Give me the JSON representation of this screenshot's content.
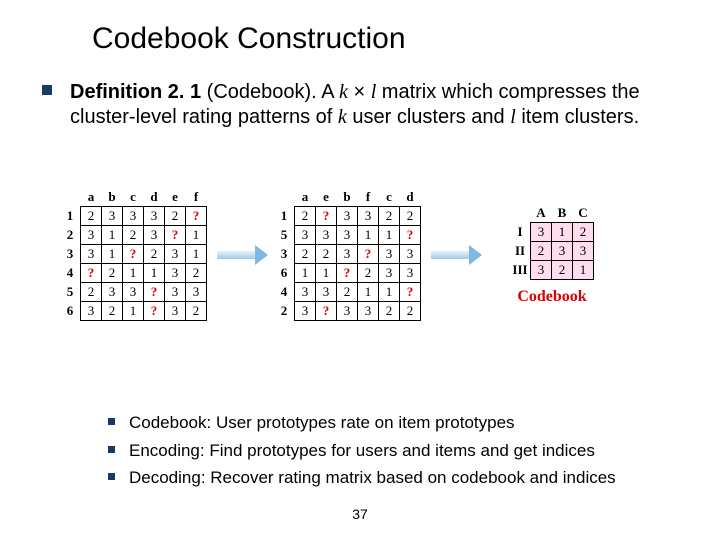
{
  "title": "Codebook Construction",
  "definition": {
    "lead_bold": "Definition 2. 1",
    "paren": " (Codebook). A ",
    "k": "k",
    "times": " × ",
    "l": "l",
    "tail1": " matrix which compresses the cluster-level rating patterns of ",
    "k2": "k",
    "tail2": " user clusters and ",
    "l2": "l",
    "tail3": " item clusters."
  },
  "matrix1": {
    "cols": [
      "a",
      "b",
      "c",
      "d",
      "e",
      "f"
    ],
    "rows": [
      "1",
      "2",
      "3",
      "4",
      "5",
      "6"
    ],
    "cells": [
      [
        "2",
        "3",
        "3",
        "3",
        "2",
        "?"
      ],
      [
        "3",
        "1",
        "2",
        "3",
        "?",
        "1"
      ],
      [
        "3",
        "1",
        "?",
        "2",
        "3",
        "1"
      ],
      [
        "?",
        "2",
        "1",
        "1",
        "3",
        "2"
      ],
      [
        "2",
        "3",
        "3",
        "?",
        "3",
        "3"
      ],
      [
        "3",
        "2",
        "1",
        "?",
        "3",
        "2"
      ]
    ]
  },
  "matrix2": {
    "cols": [
      "a",
      "e",
      "b",
      "f",
      "c",
      "d"
    ],
    "rows": [
      "1",
      "5",
      "3",
      "6",
      "4",
      "2"
    ],
    "cells": [
      [
        "2",
        "?",
        "3",
        "3",
        "2",
        "2"
      ],
      [
        "3",
        "3",
        "3",
        "1",
        "1",
        "?"
      ],
      [
        "2",
        "2",
        "3",
        "?",
        "3",
        "3"
      ],
      [
        "1",
        "1",
        "?",
        "2",
        "3",
        "3"
      ],
      [
        "3",
        "3",
        "2",
        "1",
        "1",
        "?"
      ],
      [
        "3",
        "?",
        "3",
        "3",
        "2",
        "2"
      ]
    ]
  },
  "codebook": {
    "cols": [
      "A",
      "B",
      "C"
    ],
    "rows": [
      "I",
      "II",
      "III"
    ],
    "cells": [
      [
        "3",
        "1",
        "2"
      ],
      [
        "2",
        "3",
        "3"
      ],
      [
        "3",
        "2",
        "1"
      ]
    ],
    "label": "Codebook"
  },
  "bullets": [
    "Codebook: User prototypes rate on item prototypes",
    "Encoding: Find prototypes for users and items and get indices",
    "Decoding: Recover rating matrix based on codebook and indices"
  ],
  "pagenum": "37"
}
